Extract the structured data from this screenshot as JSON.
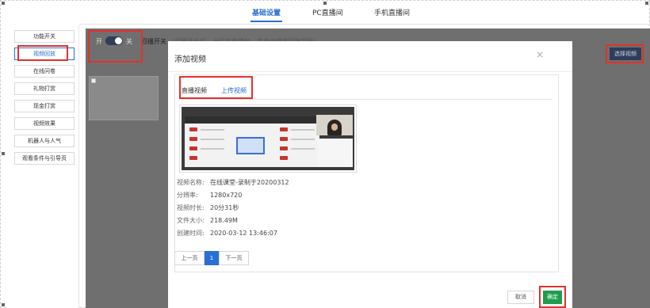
{
  "top_tabs": [
    {
      "label": "基础设置",
      "active": true
    },
    {
      "label": "PC直播间",
      "active": false
    },
    {
      "label": "手机直播间",
      "active": false
    }
  ],
  "sidebar": {
    "items": [
      {
        "label": "功能开关"
      },
      {
        "label": "视频回放"
      },
      {
        "label": "在线问卷"
      },
      {
        "label": "礼物打赏"
      },
      {
        "label": "现金打赏"
      },
      {
        "label": "视频效果"
      },
      {
        "label": "机器人与人气"
      },
      {
        "label": "观看条件与引导页"
      }
    ],
    "active_index": 1
  },
  "main": {
    "toggle_on_label": "开",
    "toggle_off_label": "关",
    "replay_switch_label": "回播开关",
    "bg_hint": "（回放开启后，当没有直播时，将自动播放回放视频）",
    "select_video_button": "选择视频"
  },
  "modal": {
    "title": "添加视频",
    "close_icon": "×",
    "tabs": [
      {
        "label": "直播视频",
        "active": false
      },
      {
        "label": "上传视频",
        "active": true
      }
    ],
    "video": {
      "name_label": "视频名称:",
      "name_value": "在线课堂-录制于20200312",
      "resolution_label": "分辨率:",
      "resolution_value": "1280x720",
      "duration_label": "视频时长:",
      "duration_value": "20分31秒",
      "size_label": "文件大小:",
      "size_value": "218.49M",
      "created_label": "创建时间:",
      "created_value": "2020-03-12 13:46:07"
    },
    "pager": {
      "prev": "上一页",
      "current": "1",
      "next": "下一页"
    },
    "cancel_button": "取消",
    "confirm_button": "确定"
  },
  "colors": {
    "accent": "#2a6fd6",
    "highlight": "#e0322b",
    "confirm": "#1f9d4e",
    "overlay": "#6f6f6f"
  }
}
